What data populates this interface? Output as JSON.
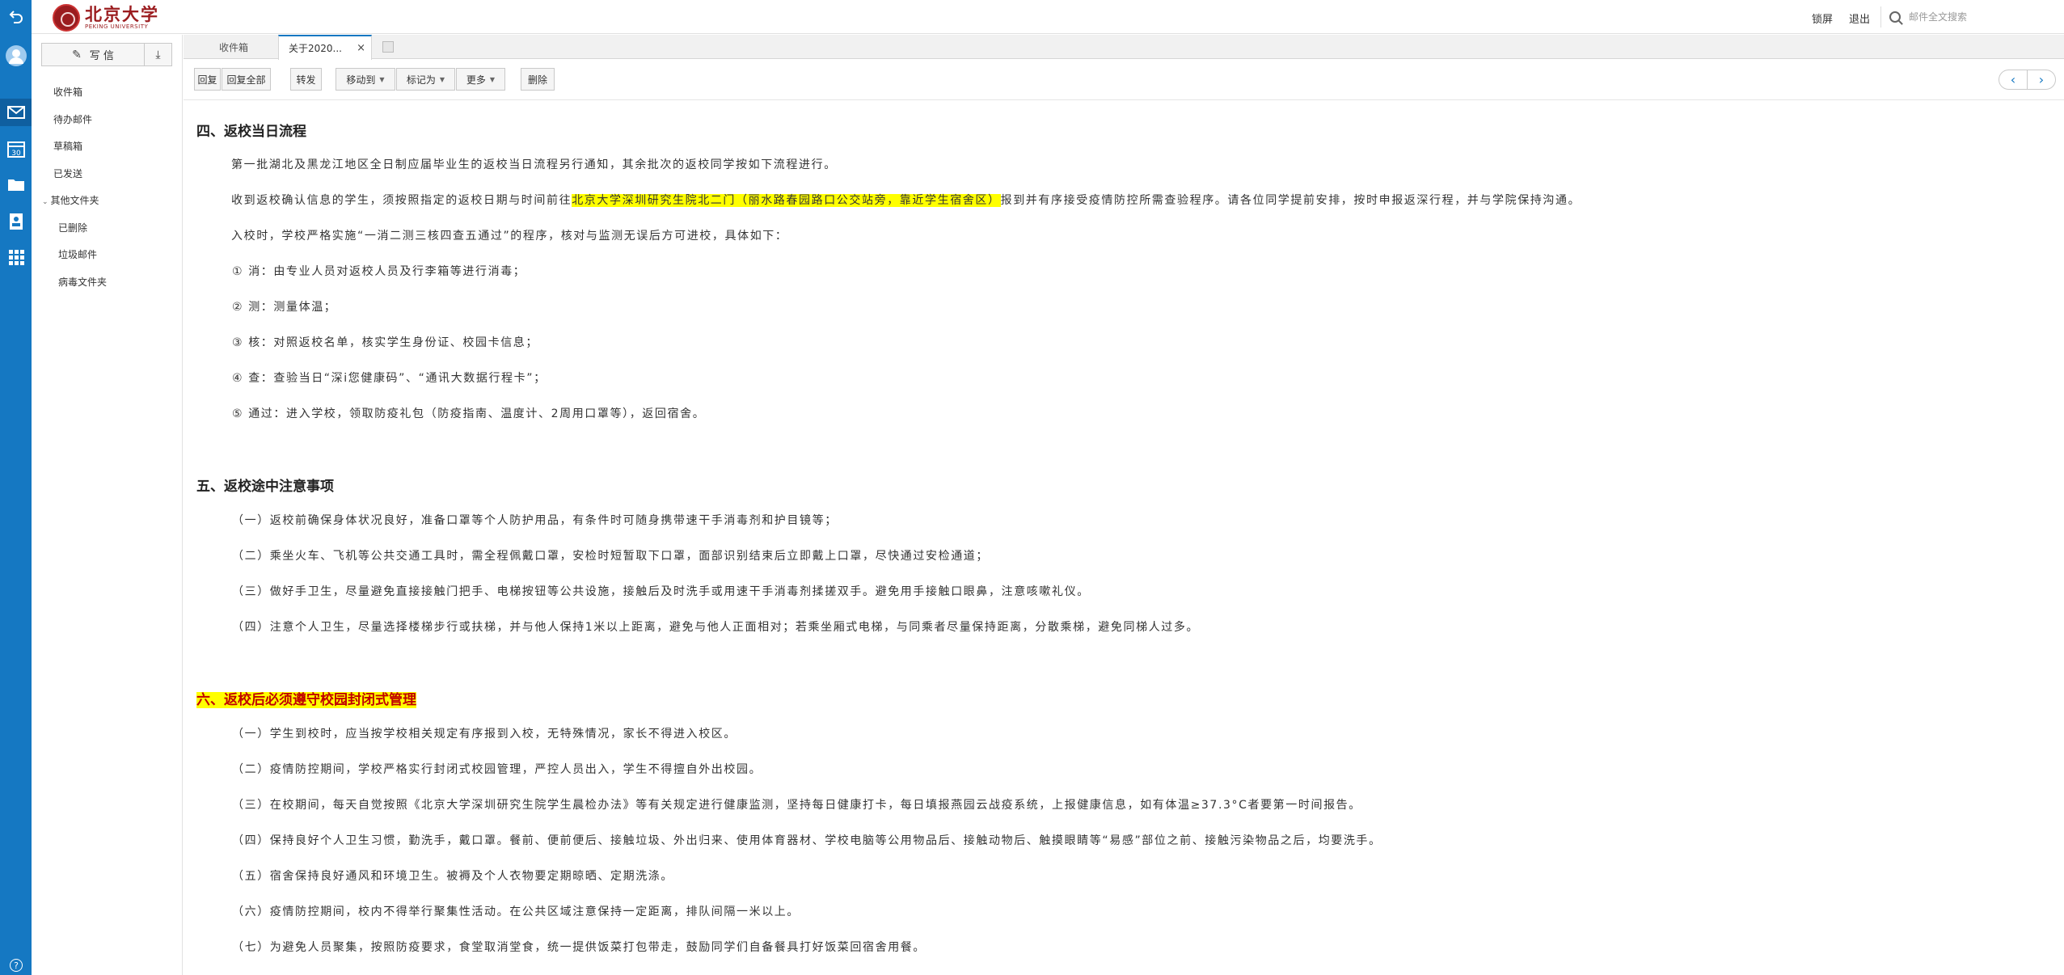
{
  "vnav": {
    "icons": [
      "back-icon",
      "avatar",
      "mail-icon",
      "calendar-icon",
      "folder-icon",
      "contacts-icon",
      "apps-icon",
      "help-icon"
    ],
    "calendar_day": "30"
  },
  "header": {
    "logo_cn": "北京大学",
    "logo_en": "PEKING UNIVERSITY",
    "lock_label": "锁屏",
    "logout_label": "退出",
    "search_placeholder": "邮件全文搜索"
  },
  "sidebar": {
    "compose_label": "写 信",
    "folders": [
      "收件箱",
      "待办邮件",
      "草稿箱",
      "已发送"
    ],
    "other_folders_label": "其他文件夹",
    "subfolders": [
      "已删除",
      "垃圾邮件",
      "病毒文件夹"
    ]
  },
  "tabs": {
    "inbox_label": "收件箱",
    "active_label": "关于2020...",
    "close_symbol": "×"
  },
  "toolbar": {
    "reply": "回复",
    "reply_all": "回复全部",
    "forward": "转发",
    "move_to": "移动到",
    "mark_as": "标记为",
    "more": "更多",
    "delete": "删除"
  },
  "email": {
    "section4": {
      "title": "四、返校当日流程",
      "p1": "第一批湖北及黑龙江地区全日制应届毕业生的返校当日流程另行通知，其余批次的返校同学按如下流程进行。",
      "p2_before": "收到返校确认信息的学生，须按照指定的返校日期与时间前往",
      "p2_highlight": "北京大学深圳研究生院北二门（丽水路春园路口公交站旁，靠近学生宿舍区）",
      "p2_after": "报到并有序接受疫情防控所需查验程序。请各位同学提前安排，按时申报返深行程，并与学院保持沟通。",
      "p3": "入校时，学校严格实施“一消二测三核四查五通过”的程序，核对与监测无误后方可进校，具体如下：",
      "steps": [
        "① 消：由专业人员对返校人员及行李箱等进行消毒；",
        "② 测：测量体温；",
        "③ 核：对照返校名单，核实学生身份证、校园卡信息；",
        "④ 查：查验当日“深i您健康码”、“通讯大数据行程卡”；",
        "⑤ 通过：进入学校，领取防疫礼包（防疫指南、温度计、2周用口罩等），返回宿舍。"
      ]
    },
    "section5": {
      "title": "五、返校途中注意事项",
      "items": [
        "（一）返校前确保身体状况良好，准备口罩等个人防护用品，有条件时可随身携带速干手消毒剂和护目镜等；",
        "（二）乘坐火车、飞机等公共交通工具时，需全程佩戴口罩，安检时短暂取下口罩，面部识别结束后立即戴上口罩，尽快通过安检通道；",
        "（三）做好手卫生，尽量避免直接接触门把手、电梯按钮等公共设施，接触后及时洗手或用速干手消毒剂揉搓双手。避免用手接触口眼鼻，注意咳嗽礼仪。",
        "（四）注意个人卫生，尽量选择楼梯步行或扶梯，并与他人保持1米以上距离，避免与他人正面相对；若乘坐厢式电梯，与同乘者尽量保持距离，分散乘梯，避免同梯人过多。"
      ]
    },
    "section6": {
      "title": "六、返校后必须遵守校园封闭式管理",
      "items": [
        "（一）学生到校时，应当按学校相关规定有序报到入校，无特殊情况，家长不得进入校区。",
        "（二）疫情防控期间，学校严格实行封闭式校园管理，严控人员出入，学生不得擅自外出校园。",
        "（三）在校期间，每天自觉按照《北京大学深圳研究生院学生晨检办法》等有关规定进行健康监测，坚持每日健康打卡，每日填报燕园云战疫系统，上报健康信息，如有体温≥37.3°C者要第一时间报告。",
        "（四）保持良好个人卫生习惯，勤洗手，戴口罩。餐前、便前便后、接触垃圾、外出归来、使用体育器材、学校电脑等公用物品后、接触动物后、触摸眼睛等“易感”部位之前、接触污染物品之后，均要洗手。",
        "（五）宿舍保持良好通风和环境卫生。被褥及个人衣物要定期晾晒、定期洗涤。",
        "（六）疫情防控期间，校内不得举行聚集性活动。在公共区域注意保持一定距离，排队间隔一米以上。",
        "（七）为避免人员聚集，按照防疫要求，食堂取消堂食，统一提供饭菜打包带走，鼓励同学们自备餐具打好饭菜回宿舍用餐。"
      ]
    }
  },
  "colors": {
    "nav_blue": "#1578c2",
    "highlight": "#ffff00",
    "heading_red": "#c00000",
    "logo_red": "#9b1c1f"
  }
}
